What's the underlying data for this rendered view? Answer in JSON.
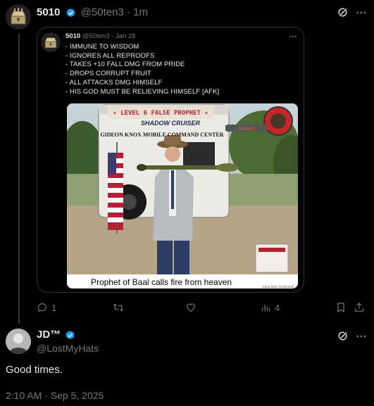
{
  "main_post": {
    "author_name": "5010",
    "author_handle": "@50ten3",
    "separator": "·",
    "time": "1m"
  },
  "quoted_post": {
    "author_name": "5010",
    "author_handle": "@50ten3",
    "separator": "·",
    "date": "Jan 28",
    "lines": [
      "- IMMUNE TO WISDOM",
      "- IGNORES ALL REPROOFS",
      "- TAKES +10 FALL DMG FROM PRIDE",
      "- DROPS CORRUPT FRUIT",
      "- ALL ATTACKS DMG HIMSELF",
      "- HIS GOD MUST BE RELIEVING HIMSELF [AFK]"
    ],
    "media": {
      "banner": "✦ LEVEL 6 FALSE PROPHET ✦",
      "trailer_brand": "SHADOW CRUISER",
      "trailer_text": "GIDEON KNOX MOBILE COMMAND CENTER",
      "badge": "50ten3",
      "caption": "Prophet of Baal calls fire from heaven",
      "credit": "Circa 2021 (Colorized)"
    }
  },
  "main_actions": {
    "reply_count": "1",
    "views_count": "4"
  },
  "reply": {
    "author_name": "JD™",
    "author_handle": "@LostMyHats",
    "text": "Good times.",
    "timestamp": "2:10 AM · Sep 5, 2025"
  },
  "colors": {
    "background": "#000000",
    "text": "#e7e9ea",
    "muted": "#71767b",
    "verified": "#1d9bf0",
    "border": "#2f3336"
  }
}
